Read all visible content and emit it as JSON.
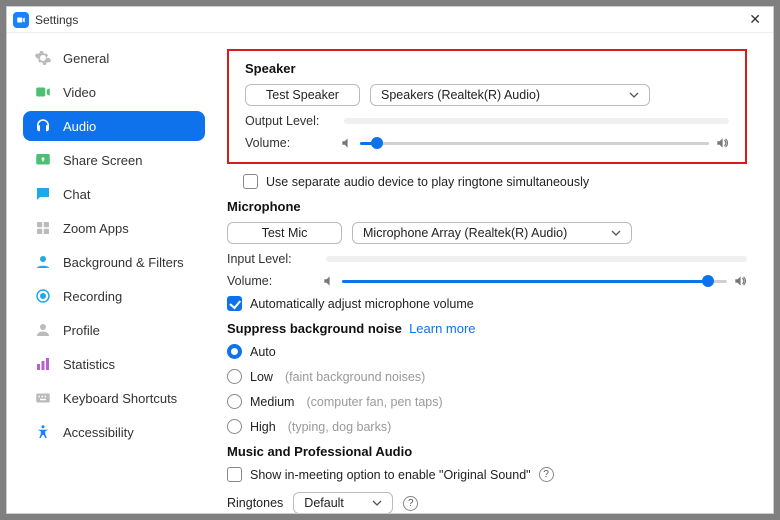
{
  "window": {
    "title": "Settings"
  },
  "sidebar": {
    "items": [
      {
        "label": "General"
      },
      {
        "label": "Video"
      },
      {
        "label": "Audio"
      },
      {
        "label": "Share Screen"
      },
      {
        "label": "Chat"
      },
      {
        "label": "Zoom Apps"
      },
      {
        "label": "Background & Filters"
      },
      {
        "label": "Recording"
      },
      {
        "label": "Profile"
      },
      {
        "label": "Statistics"
      },
      {
        "label": "Keyboard Shortcuts"
      },
      {
        "label": "Accessibility"
      }
    ]
  },
  "speaker": {
    "title": "Speaker",
    "test_label": "Test Speaker",
    "device": "Speakers (Realtek(R) Audio)",
    "output_level_label": "Output Level:",
    "volume_label": "Volume:",
    "volume_percent": 5,
    "separate_ringtone_label": "Use separate audio device to play ringtone simultaneously",
    "separate_ringtone_checked": false
  },
  "microphone": {
    "title": "Microphone",
    "test_label": "Test Mic",
    "device": "Microphone Array (Realtek(R) Audio)",
    "input_level_label": "Input Level:",
    "volume_label": "Volume:",
    "volume_percent": 95,
    "auto_adjust_label": "Automatically adjust microphone volume",
    "auto_adjust_checked": true
  },
  "suppress": {
    "title": "Suppress background noise",
    "learn_more": "Learn more",
    "selected": "auto",
    "options": {
      "auto": {
        "label": "Auto",
        "hint": ""
      },
      "low": {
        "label": "Low",
        "hint": "(faint background noises)"
      },
      "medium": {
        "label": "Medium",
        "hint": "(computer fan, pen taps)"
      },
      "high": {
        "label": "High",
        "hint": "(typing, dog barks)"
      }
    }
  },
  "music": {
    "title": "Music and Professional Audio",
    "original_sound_label": "Show in-meeting option to enable \"Original Sound\"",
    "original_sound_checked": false
  },
  "ringtones": {
    "label": "Ringtones",
    "value": "Default"
  }
}
